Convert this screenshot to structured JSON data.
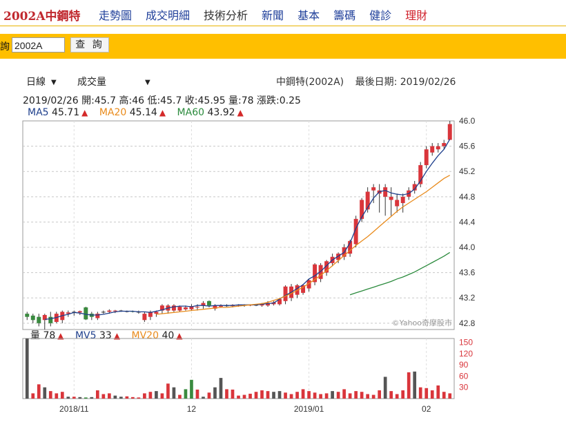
{
  "topnav": {
    "stock_title": "2002A中鋼特",
    "links": [
      {
        "label": "走勢圖",
        "style": "blue"
      },
      {
        "label": "成交明細",
        "style": "blue"
      },
      {
        "label": "技術分析",
        "style": "dark"
      },
      {
        "label": "新聞",
        "style": "blue"
      },
      {
        "label": "基本",
        "style": "blue"
      },
      {
        "label": "籌碼",
        "style": "blue"
      },
      {
        "label": "健診",
        "style": "blue"
      },
      {
        "label": "理財",
        "style": "red"
      }
    ]
  },
  "query": {
    "label": "詢",
    "input_value": "2002A",
    "button_label": "查 詢"
  },
  "controls": {
    "period": "日線",
    "indicator": "成交量"
  },
  "header": {
    "stock_name": "中鋼特(2002A)",
    "last_date_label": "最後日期: 2019/02/26"
  },
  "ohlc_line": "2019/02/26  開:45.7  高:46  低:45.7  收:45.95  量:78  漲跌:0.25",
  "ma_legend": {
    "ma5": "MA5",
    "ma5_val": "45.71",
    "ma20": "MA20",
    "ma20_val": "45.14",
    "ma60": "MA60",
    "ma60_val": "43.92"
  },
  "vol_legend": {
    "vol": "量",
    "vol_val": "78",
    "mv5": "MV5",
    "mv5_val": "33",
    "mv20": "MV20",
    "mv20_val": "40"
  },
  "watermark": "©Yahoo奇摩股市",
  "colors": {
    "up": "#d9353b",
    "down": "#3a8a3f",
    "flat": "#555555",
    "ma5": "#1e3f8c",
    "ma20": "#e98a1a",
    "ma60": "#2a8a3c",
    "accent": "#ffbf00"
  },
  "chart_data": {
    "type": "candlestick",
    "price_ticks": [
      "46.0",
      "45.6",
      "45.2",
      "44.8",
      "44.4",
      "44.0",
      "43.6",
      "43.2",
      "42.8"
    ],
    "price_ylim": [
      42.7,
      46.0
    ],
    "volume_ticks": [
      "150",
      "120",
      "90",
      "60",
      "30"
    ],
    "volume_ylim": [
      0,
      160
    ],
    "x_labels": [
      "2018/11",
      "12",
      "2019/01",
      "02"
    ],
    "candles": [
      {
        "o": 42.95,
        "h": 42.98,
        "l": 42.85,
        "c": 42.9
      },
      {
        "o": 42.92,
        "h": 42.95,
        "l": 42.8,
        "c": 42.85
      },
      {
        "o": 42.9,
        "h": 42.95,
        "l": 42.75,
        "c": 42.8
      },
      {
        "o": 42.85,
        "h": 42.95,
        "l": 42.7,
        "c": 42.93
      },
      {
        "o": 42.9,
        "h": 42.98,
        "l": 42.75,
        "c": 42.8
      },
      {
        "o": 42.82,
        "h": 42.98,
        "l": 42.8,
        "c": 42.95
      },
      {
        "o": 42.85,
        "h": 43.0,
        "l": 42.8,
        "c": 42.98
      },
      {
        "o": 42.95,
        "h": 43.0,
        "l": 42.9,
        "c": 42.97
      },
      {
        "o": 42.98,
        "h": 43.0,
        "l": 42.92,
        "c": 42.98
      },
      {
        "o": 42.97,
        "h": 43.0,
        "l": 42.93,
        "c": 42.99
      },
      {
        "o": 43.05,
        "h": 43.06,
        "l": 42.85,
        "c": 42.86
      },
      {
        "o": 42.95,
        "h": 42.98,
        "l": 42.85,
        "c": 42.9
      },
      {
        "o": 42.88,
        "h": 42.98,
        "l": 42.85,
        "c": 42.95
      },
      {
        "o": 42.98,
        "h": 43.0,
        "l": 42.95,
        "c": 42.98
      },
      {
        "o": 42.98,
        "h": 43.02,
        "l": 42.95,
        "c": 43.0
      },
      {
        "o": 42.99,
        "h": 43.01,
        "l": 42.96,
        "c": 43.0
      },
      {
        "o": 43.0,
        "h": 43.01,
        "l": 42.98,
        "c": 43.0
      },
      {
        "o": 42.99,
        "h": 43.0,
        "l": 42.97,
        "c": 42.99
      },
      {
        "o": 42.99,
        "h": 43.0,
        "l": 42.97,
        "c": 42.98
      },
      {
        "o": 42.98,
        "h": 43.0,
        "l": 42.95,
        "c": 42.98
      },
      {
        "o": 42.85,
        "h": 42.98,
        "l": 42.82,
        "c": 42.95
      },
      {
        "o": 42.9,
        "h": 43.0,
        "l": 42.85,
        "c": 42.98
      },
      {
        "o": 42.95,
        "h": 43.0,
        "l": 42.9,
        "c": 42.98
      },
      {
        "o": 43.0,
        "h": 43.1,
        "l": 42.95,
        "c": 43.08
      },
      {
        "o": 43.0,
        "h": 43.1,
        "l": 42.95,
        "c": 43.08
      },
      {
        "o": 43.0,
        "h": 43.1,
        "l": 42.98,
        "c": 43.08
      },
      {
        "o": 43.0,
        "h": 43.08,
        "l": 42.98,
        "c": 43.06
      },
      {
        "o": 43.02,
        "h": 43.08,
        "l": 43.0,
        "c": 43.05
      },
      {
        "o": 43.02,
        "h": 43.1,
        "l": 43.0,
        "c": 43.07
      },
      {
        "o": 43.05,
        "h": 43.1,
        "l": 43.0,
        "c": 43.06
      },
      {
        "o": 43.08,
        "h": 43.15,
        "l": 43.03,
        "c": 43.12
      },
      {
        "o": 43.15,
        "h": 43.16,
        "l": 43.05,
        "c": 43.08
      },
      {
        "o": 43.03,
        "h": 43.1,
        "l": 43.0,
        "c": 43.08
      },
      {
        "o": 43.06,
        "h": 43.1,
        "l": 43.05,
        "c": 43.08
      },
      {
        "o": 43.08,
        "h": 43.1,
        "l": 43.06,
        "c": 43.08
      },
      {
        "o": 43.07,
        "h": 43.1,
        "l": 43.05,
        "c": 43.09
      },
      {
        "o": 43.08,
        "h": 43.1,
        "l": 43.06,
        "c": 43.09
      },
      {
        "o": 43.08,
        "h": 43.1,
        "l": 43.06,
        "c": 43.09
      },
      {
        "o": 43.08,
        "h": 43.1,
        "l": 43.07,
        "c": 43.09
      },
      {
        "o": 43.09,
        "h": 43.1,
        "l": 43.07,
        "c": 43.09
      },
      {
        "o": 43.08,
        "h": 43.12,
        "l": 43.06,
        "c": 43.1
      },
      {
        "o": 43.08,
        "h": 43.15,
        "l": 43.06,
        "c": 43.12
      },
      {
        "o": 43.1,
        "h": 43.15,
        "l": 43.08,
        "c": 43.13
      },
      {
        "o": 43.1,
        "h": 43.2,
        "l": 43.08,
        "c": 43.18
      },
      {
        "o": 43.15,
        "h": 43.4,
        "l": 43.1,
        "c": 43.38
      },
      {
        "o": 43.2,
        "h": 43.42,
        "l": 43.15,
        "c": 43.38
      },
      {
        "o": 43.25,
        "h": 43.42,
        "l": 43.2,
        "c": 43.4
      },
      {
        "o": 43.28,
        "h": 43.42,
        "l": 43.25,
        "c": 43.4
      },
      {
        "o": 43.35,
        "h": 43.5,
        "l": 43.3,
        "c": 43.48
      },
      {
        "o": 43.45,
        "h": 43.75,
        "l": 43.4,
        "c": 43.73
      },
      {
        "o": 43.5,
        "h": 43.75,
        "l": 43.45,
        "c": 43.72
      },
      {
        "o": 43.6,
        "h": 43.8,
        "l": 43.55,
        "c": 43.78
      },
      {
        "o": 43.75,
        "h": 43.9,
        "l": 43.7,
        "c": 43.85
      },
      {
        "o": 43.8,
        "h": 43.92,
        "l": 43.75,
        "c": 43.9
      },
      {
        "o": 43.85,
        "h": 44.05,
        "l": 43.8,
        "c": 44.0
      },
      {
        "o": 43.9,
        "h": 44.12,
        "l": 43.85,
        "c": 44.1
      },
      {
        "o": 44.05,
        "h": 44.5,
        "l": 44.0,
        "c": 44.45
      },
      {
        "o": 44.45,
        "h": 44.78,
        "l": 44.4,
        "c": 44.75
      },
      {
        "o": 44.6,
        "h": 44.95,
        "l": 44.55,
        "c": 44.88
      },
      {
        "o": 44.9,
        "h": 45.0,
        "l": 44.7,
        "c": 44.95
      },
      {
        "o": 44.85,
        "h": 45.0,
        "l": 44.55,
        "c": 44.9
      },
      {
        "o": 44.8,
        "h": 45.0,
        "l": 44.5,
        "c": 44.95
      },
      {
        "o": 44.75,
        "h": 44.95,
        "l": 44.5,
        "c": 44.8
      },
      {
        "o": 44.65,
        "h": 44.85,
        "l": 44.55,
        "c": 44.75
      },
      {
        "o": 44.7,
        "h": 44.85,
        "l": 44.55,
        "c": 44.8
      },
      {
        "o": 44.8,
        "h": 44.95,
        "l": 44.75,
        "c": 44.9
      },
      {
        "o": 44.9,
        "h": 45.05,
        "l": 44.85,
        "c": 45.0
      },
      {
        "o": 45.0,
        "h": 45.35,
        "l": 44.95,
        "c": 45.3
      },
      {
        "o": 45.3,
        "h": 45.6,
        "l": 45.25,
        "c": 45.55
      },
      {
        "o": 45.5,
        "h": 45.65,
        "l": 45.45,
        "c": 45.6
      },
      {
        "o": 45.55,
        "h": 45.65,
        "l": 45.5,
        "c": 45.6
      },
      {
        "o": 45.6,
        "h": 45.7,
        "l": 45.55,
        "c": 45.65
      },
      {
        "o": 45.7,
        "h": 46.0,
        "l": 45.7,
        "c": 45.95
      }
    ],
    "volume": [
      160,
      14,
      38,
      30,
      20,
      14,
      18,
      5,
      5,
      4,
      3,
      4,
      22,
      12,
      14,
      8,
      5,
      6,
      4,
      3,
      14,
      18,
      20,
      14,
      40,
      30,
      10,
      25,
      50,
      24,
      5,
      16,
      30,
      55,
      25,
      24,
      8,
      10,
      13,
      18,
      22,
      20,
      18,
      20,
      16,
      12,
      18,
      25,
      20,
      16,
      12,
      14,
      20,
      18,
      25,
      14,
      20,
      18,
      12,
      10,
      22,
      58,
      20,
      12,
      22,
      70,
      72,
      30,
      28,
      22,
      35,
      18,
      14,
      20,
      24,
      60,
      45,
      24,
      18,
      28,
      40,
      12,
      36,
      78
    ],
    "volume_colors": [
      "flat",
      "up",
      "up",
      "flat",
      "up",
      "up",
      "up",
      "flat",
      "up",
      "flat",
      "down",
      "flat",
      "up",
      "up",
      "up",
      "flat",
      "flat",
      "up",
      "up",
      "up",
      "up",
      "up",
      "flat",
      "up",
      "up",
      "flat",
      "up",
      "down",
      "down",
      "up",
      "flat",
      "up",
      "flat",
      "flat",
      "up",
      "up",
      "up",
      "up",
      "up",
      "up",
      "up",
      "up",
      "flat",
      "flat",
      "up",
      "up",
      "up",
      "up",
      "up",
      "up",
      "up",
      "up",
      "flat",
      "up",
      "up",
      "up",
      "up",
      "up",
      "up",
      "up",
      "up",
      "flat",
      "up",
      "up",
      "up",
      "up",
      "flat",
      "up",
      "up",
      "up",
      "up",
      "up",
      "up",
      "up",
      "up",
      "flat",
      "up",
      "flat",
      "flat",
      "up",
      "down",
      "up",
      "flat",
      "up",
      "up"
    ],
    "ma5": [
      null,
      null,
      null,
      null,
      42.86,
      42.87,
      42.89,
      42.92,
      42.94,
      42.97,
      42.96,
      42.94,
      42.93,
      42.93,
      42.94,
      42.96,
      42.98,
      42.99,
      42.99,
      42.99,
      42.98,
      42.98,
      42.97,
      42.99,
      43.01,
      43.04,
      43.06,
      43.07,
      43.07,
      43.06,
      43.08,
      43.08,
      43.07,
      43.08,
      43.08,
      43.08,
      43.08,
      43.09,
      43.09,
      43.09,
      43.09,
      43.1,
      43.11,
      43.12,
      43.18,
      43.24,
      43.29,
      43.35,
      43.41,
      43.5,
      43.55,
      43.62,
      43.71,
      43.8,
      43.86,
      43.92,
      44.07,
      44.3,
      44.48,
      44.63,
      44.78,
      44.88,
      44.9,
      44.86,
      44.84,
      44.83,
      44.85,
      44.92,
      45.05,
      45.2,
      45.33,
      45.45,
      45.55,
      45.71
    ],
    "ma20": [
      null,
      null,
      null,
      null,
      null,
      null,
      null,
      null,
      null,
      null,
      null,
      null,
      null,
      null,
      null,
      null,
      null,
      null,
      null,
      42.94,
      42.95,
      42.96,
      42.97,
      42.98,
      42.99,
      43.0,
      43.01,
      43.02,
      43.03,
      43.04,
      43.05,
      43.05,
      43.06,
      43.07,
      43.08,
      43.09,
      43.1,
      43.11,
      43.13,
      43.16,
      43.19,
      43.23,
      43.27,
      43.32,
      43.37,
      43.43,
      43.49,
      43.56,
      43.63,
      43.71,
      43.79,
      43.87,
      43.95,
      44.03,
      44.1,
      44.17,
      44.25,
      44.33,
      44.41,
      44.49,
      44.57,
      44.64,
      44.7,
      44.76,
      44.82,
      44.88,
      44.95,
      45.02,
      45.09,
      45.14
    ],
    "ma60": [
      null,
      null,
      null,
      null,
      null,
      null,
      null,
      null,
      null,
      null,
      null,
      null,
      null,
      null,
      null,
      null,
      null,
      null,
      null,
      null,
      null,
      null,
      null,
      null,
      null,
      null,
      null,
      null,
      null,
      null,
      null,
      null,
      null,
      null,
      null,
      null,
      null,
      null,
      null,
      null,
      null,
      null,
      null,
      null,
      null,
      null,
      null,
      null,
      null,
      null,
      null,
      null,
      null,
      null,
      null,
      null,
      null,
      null,
      null,
      43.25,
      43.28,
      43.31,
      43.34,
      43.37,
      43.4,
      43.43,
      43.46,
      43.5,
      43.53,
      43.57,
      43.61,
      43.66,
      43.71,
      43.76,
      43.81,
      43.86,
      43.92
    ]
  }
}
